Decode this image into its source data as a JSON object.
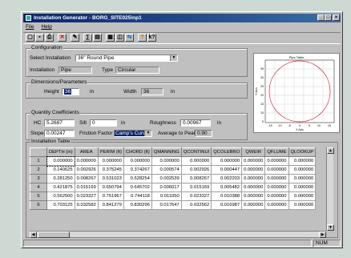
{
  "window": {
    "title": "Installation Generator - BORG_SITE025\\np1"
  },
  "menu": {
    "file": "File",
    "help": "Help"
  },
  "toolbar": {
    "icons": [
      "new-icon",
      "save-icon",
      "print-icon",
      "delete-icon",
      "edit-icon",
      "calc-icon",
      "table-icon",
      "chart-icon",
      "layers-icon",
      "export-icon",
      "help-icon",
      "context-help-icon"
    ]
  },
  "configuration": {
    "group_label": "Configuration",
    "select_label": "Select Installation",
    "select_value": "36\" Round Pipe",
    "installation_label": "Installation",
    "installation_value": "Pipe",
    "type_label": "Type",
    "type_value": "Circular"
  },
  "dimensions": {
    "group_label": "Dimensions/Parameters",
    "height_label": "Height",
    "height_value": "36",
    "height_unit": "in",
    "width_label": "Width",
    "width_value": "36",
    "width_unit": "in"
  },
  "quantity": {
    "group_label": "Quantity Coefficients",
    "hc_label": "HC",
    "hc_value": "5.2687",
    "silt_label": "Silt",
    "silt_value": "0",
    "silt_unit": "in",
    "roughness_label": "Roughness",
    "roughness_value": "0.00967",
    "roughness_unit": "in",
    "slope_label": "Slope",
    "slope_value": "0.00247",
    "friction_label": "Friction Factor",
    "friction_value": "Camp's Curve",
    "avg_peak_label": "Average to Peak",
    "avg_peak_value": "0.90"
  },
  "plot": {
    "title": "Pipe Table",
    "xlabel": "X Axis",
    "ylabel": "Y Axis",
    "xticks": [
      "-15",
      "-10",
      "-5",
      "0",
      "5",
      "10",
      "15"
    ],
    "yticks": [
      "35",
      "30",
      "25",
      "20",
      "15",
      "10",
      "5"
    ]
  },
  "table": {
    "group_label": "Installation Table",
    "columns": [
      "DEPTH (in)",
      "AREA",
      "PERIM (ft)",
      "CHORD (ft)",
      "QMANNING",
      "QCONTINUI",
      "QCOLEBRO",
      "QWEIR",
      "QFLUME",
      "QLOOKUP"
    ],
    "rows": [
      {
        "n": "1",
        "cells": [
          "0.000000",
          "0.000000",
          "0.000000",
          "0.000000",
          "0.000000",
          "0.000000",
          "0.000000",
          "0.000000",
          "0.000000",
          "0.000000"
        ]
      },
      {
        "n": "2",
        "cells": [
          "0.140625",
          "0.002926",
          "0.375245",
          "0.374267",
          "0.000574",
          "0.002926",
          "0.000447",
          "0.000000",
          "0.000000",
          "0.000000"
        ]
      },
      {
        "n": "3",
        "cells": [
          "0.281250",
          "0.008267",
          "0.531023",
          "0.528254",
          "0.002539",
          "0.008267",
          "0.002203",
          "0.000000",
          "0.000000",
          "0.000000"
        ]
      },
      {
        "n": "4",
        "cells": [
          "0.421875",
          "0.015169",
          "0.650794",
          "0.645702",
          "0.006017",
          "0.015169",
          "0.005482",
          "0.000000",
          "0.000000",
          "0.000000"
        ]
      },
      {
        "n": "5",
        "cells": [
          "0.562500",
          "0.023327",
          "0.751967",
          "0.744118",
          "0.011050",
          "0.023327",
          "0.010388",
          "0.000000",
          "0.000000",
          "0.000000"
        ]
      },
      {
        "n": "6",
        "cells": [
          "0.703125",
          "0.032582",
          "0.841279",
          "0.830296",
          "0.017647",
          "0.032562",
          "0.016987",
          "0.000000",
          "0.000000",
          "0.000000"
        ]
      }
    ]
  },
  "status": {
    "num": "NUM"
  }
}
